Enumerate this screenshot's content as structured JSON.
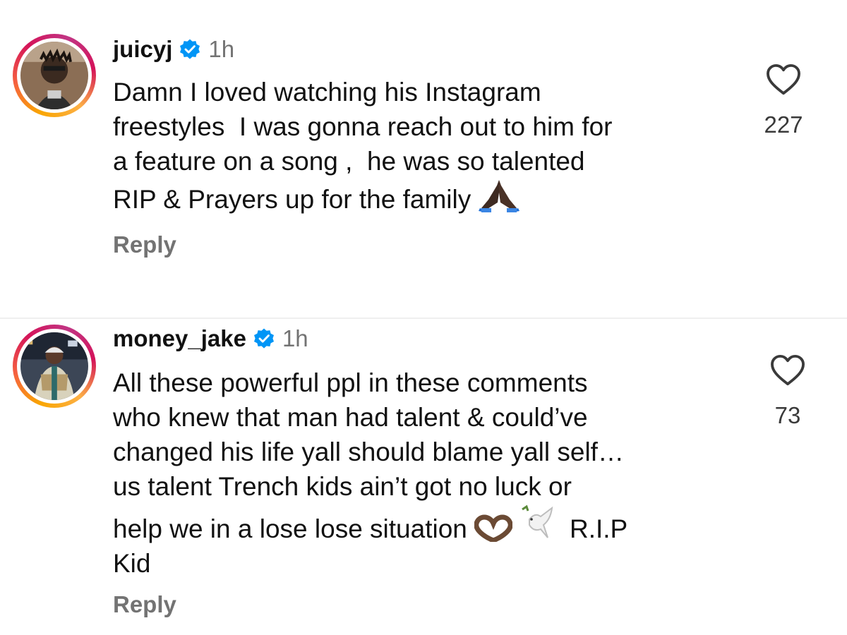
{
  "comments": [
    {
      "username": "juicyj",
      "time": "1h",
      "lines": [
        "Damn I loved watching his Instagram",
        "freestyles  I was gonna reach out to him for",
        "a feature on a song ,  he was so talented",
        "RIP & Prayers up for the family"
      ],
      "like_count": "227",
      "reply_label": "Reply",
      "emoji": [
        "praying-hands-icon"
      ]
    },
    {
      "username": "money_jake",
      "time": "1h",
      "lines": [
        "All these powerful ppl in these comments",
        "who knew that man had talent & could’ve",
        "changed his life yall should blame yall self…",
        "us talent Trench kids ain’t got no luck or",
        "help we in a lose lose situation",
        "R.I.P",
        "Kid"
      ],
      "like_count": "73",
      "reply_label": "Reply",
      "emoji": [
        "heart-hands-icon",
        "dove-icon"
      ]
    }
  ],
  "colors": {
    "verified": "#0095f6",
    "muted_text": "#737373",
    "divider": "#efefef"
  }
}
